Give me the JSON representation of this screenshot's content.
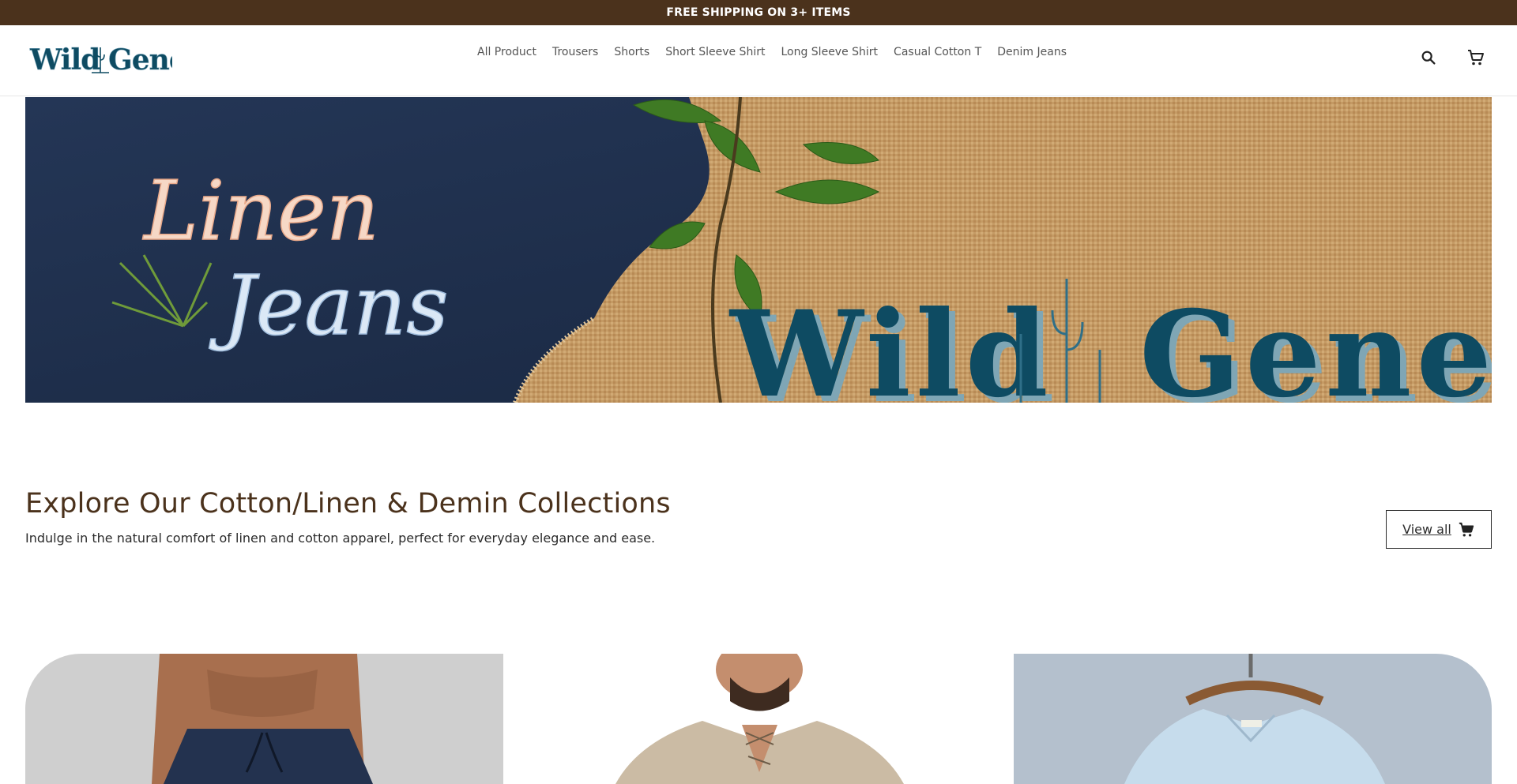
{
  "announcement": {
    "text": "FREE SHIPPING ON 3+ ITEMS"
  },
  "brand": {
    "logo_text": "Wild Gene"
  },
  "nav": {
    "items": [
      {
        "label": "All Product"
      },
      {
        "label": "Trousers"
      },
      {
        "label": "Shorts"
      },
      {
        "label": "Short Sleeve Shirt"
      },
      {
        "label": "Long Sleeve Shirt"
      },
      {
        "label": "Casual Cotton T"
      },
      {
        "label": "Denim Jeans"
      }
    ]
  },
  "header_icons": {
    "search": "search-icon",
    "cart": "cart-icon"
  },
  "banner": {
    "script_line1": "Linen",
    "script_line2": "Jeans",
    "brand_text": "Wild Gene"
  },
  "collection": {
    "title": "Explore Our Cotton/Linen & Demin Collections",
    "description": "Indulge in the natural comfort of linen and cotton apparel, perfect for everyday elegance and ease.",
    "view_all_label": "View all"
  },
  "colors": {
    "announcement_bg": "#4b321c",
    "heading": "#4b321c",
    "brand_teal": "#0e4b62",
    "banner_navy": "#1d2d4b",
    "burlap": "#c49a64"
  }
}
